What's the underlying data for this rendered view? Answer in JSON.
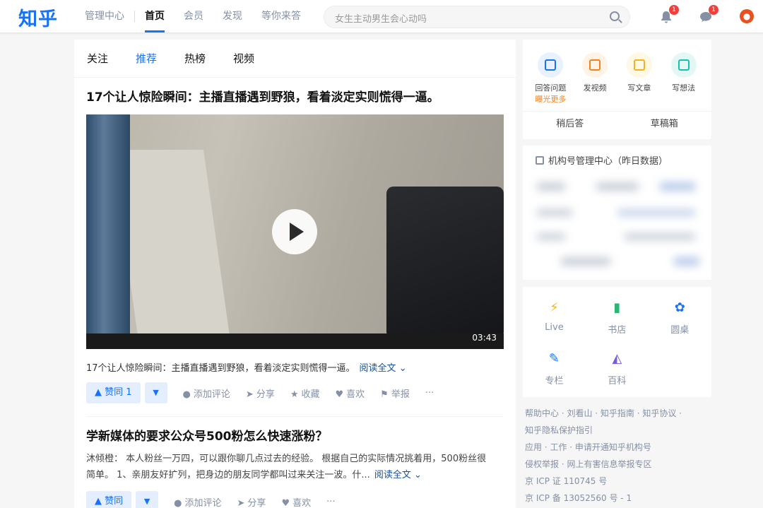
{
  "header": {
    "logo": "知乎",
    "nav": [
      "管理中心",
      "首页",
      "会员",
      "发现",
      "等你来答"
    ],
    "active_nav": "首页",
    "search_placeholder": "女生主动男生会心动吗",
    "notifications_count": "1",
    "messages_count": "1",
    "accent_color": "#1772f6"
  },
  "feed": {
    "tabs": [
      "关注",
      "推荐",
      "热榜",
      "视频"
    ],
    "active_tab": "推荐",
    "cards": [
      {
        "title": "17个让人惊险瞬间：主播直播遇到野狼，看着淡定实则慌得一逼。",
        "video_duration": "03:43",
        "excerpt": "17个让人惊险瞬间：主播直播遇到野狼，看着淡定实则慌得一逼。",
        "read_more": "阅读全文",
        "vote_up": "赞同 1",
        "comment": "添加评论",
        "share": "分享",
        "collect": "收藏",
        "like": "喜欢",
        "report": "举报",
        "more": "···"
      },
      {
        "title": "学新媒体的要求公众号500粉怎么快速涨粉？",
        "author": "沐倾橙：",
        "excerpt_line1": "本人粉丝一万四，可以跟你聊几点过去的经验。 根据自己的实际情况挑着用，500粉丝很",
        "excerpt_line2": "简单。 1、亲朋友好扩列，把身边的朋友同学都叫过来关注一波。什...",
        "read_more": "阅读全文",
        "vote_up": "赞同",
        "comment": "添加评论",
        "share": "分享",
        "like": "喜欢",
        "more": "···"
      }
    ]
  },
  "sidebar": {
    "create": [
      {
        "label": "回答问题",
        "sub": "曝光更多",
        "color": "#1772f6",
        "bg": "#e8f1ff"
      },
      {
        "label": "发视频",
        "color": "#f5821f",
        "bg": "#fff3e6"
      },
      {
        "label": "写文章",
        "color": "#f5b21f",
        "bg": "#fff8e3"
      },
      {
        "label": "写想法",
        "color": "#17c2a9",
        "bg": "#e3f8f4"
      }
    ],
    "later_answer": "稍后答",
    "drafts": "草稿箱",
    "org_center": "机构号管理中心（昨日数据）",
    "tools": [
      {
        "label": "Live",
        "icon": "lightning-icon",
        "color": "#f5b21f"
      },
      {
        "label": "书店",
        "icon": "book-icon",
        "color": "#2bb673"
      },
      {
        "label": "圆桌",
        "icon": "roundtable-icon",
        "color": "#1772f6"
      },
      {
        "label": "专栏",
        "icon": "pen-icon",
        "color": "#1772f6"
      },
      {
        "label": "百科",
        "icon": "encyclopedia-icon",
        "color": "#7a5cd6"
      }
    ]
  },
  "footer": {
    "line1": "帮助中心 · 刘看山 · 知乎指南 · 知乎协议 ·",
    "line2": "知乎隐私保护指引",
    "line3": "应用 · 工作 · 申请开通知乎机构号",
    "line4": "侵权举报 · 网上有害信息举报专区",
    "line5": "京 ICP 证 110745 号",
    "line6": "京 ICP 备 13052560 号 - 1"
  }
}
